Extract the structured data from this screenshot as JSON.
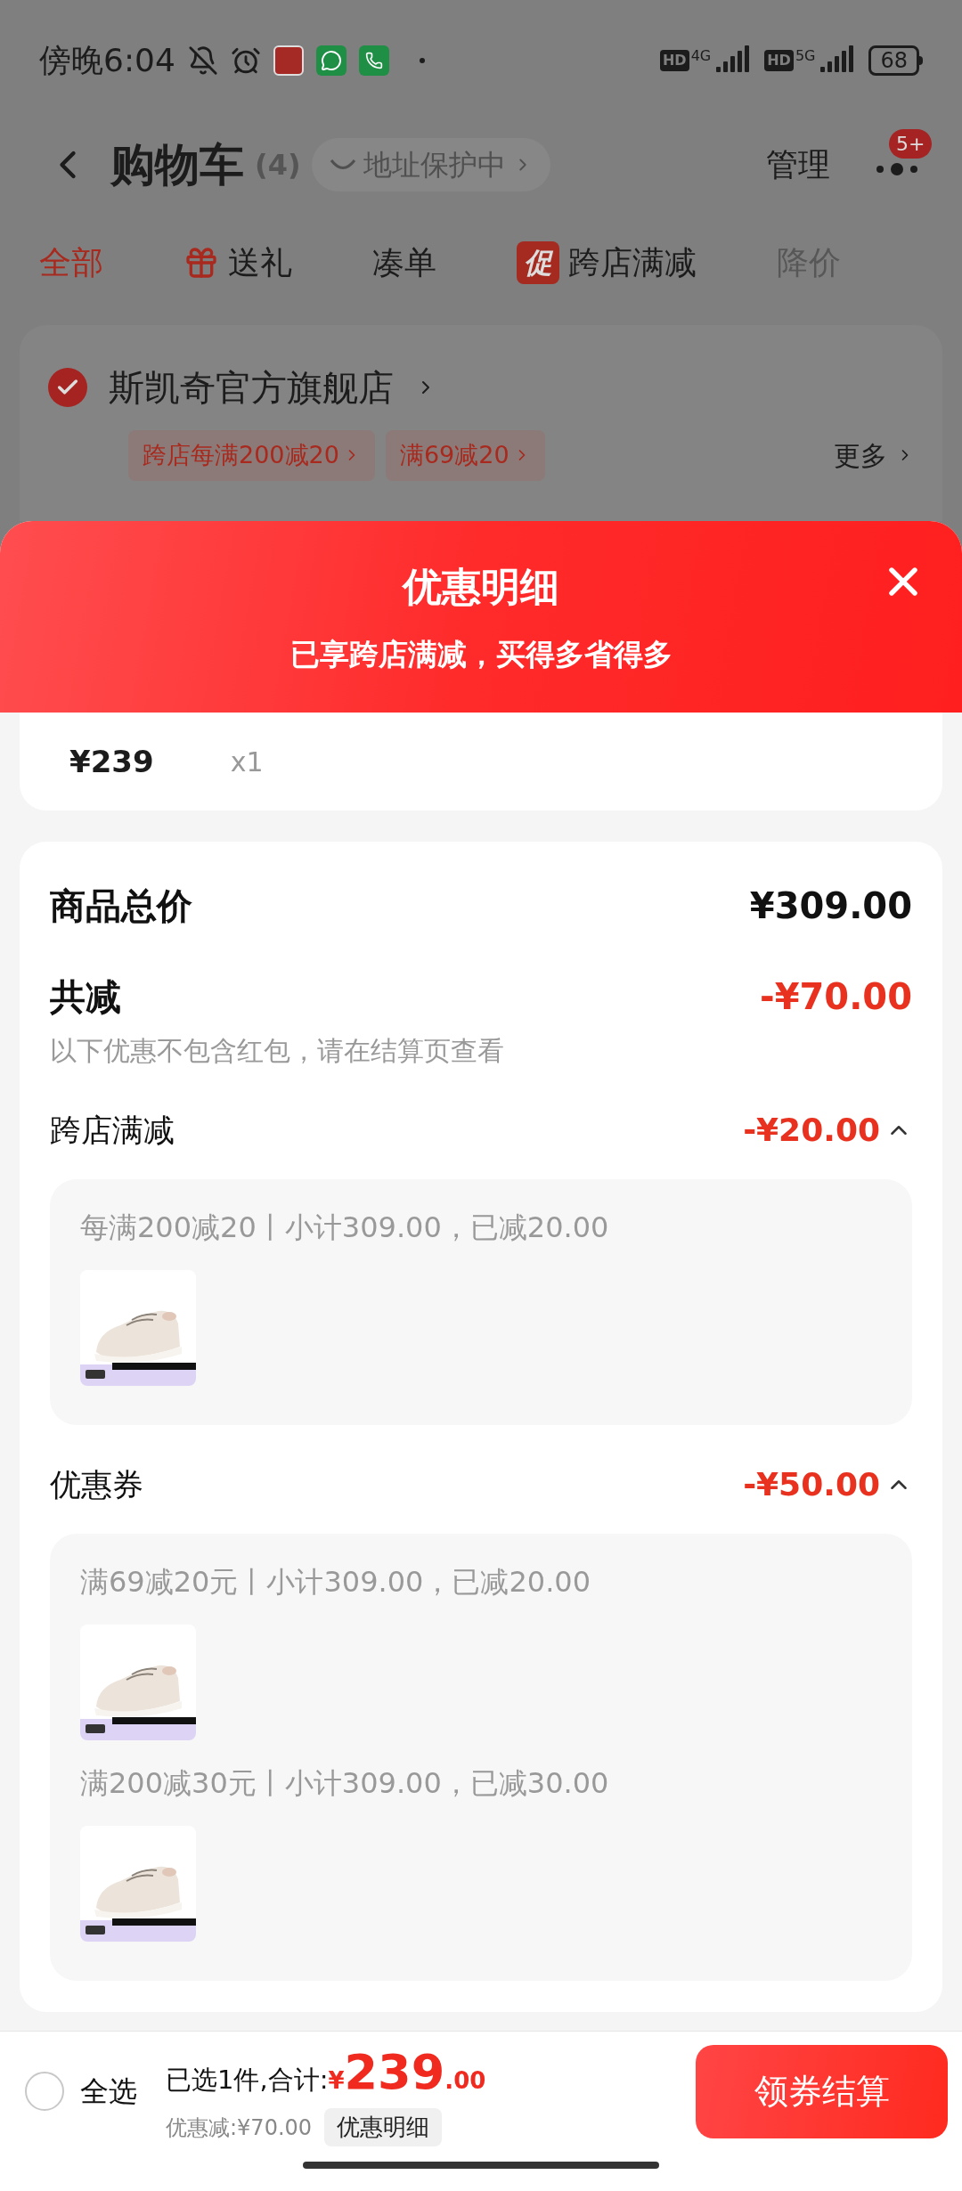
{
  "status_bar": {
    "time": "傍晚6:04",
    "network": [
      {
        "hd": "HD",
        "gen": "4G"
      },
      {
        "hd": "HD",
        "gen": "5G"
      }
    ],
    "battery": "68"
  },
  "header": {
    "title": "购物车",
    "count": "(4)",
    "address_chip": "地址保护中",
    "manage": "管理",
    "more_badge": "5+"
  },
  "tabs": [
    {
      "label": "全部",
      "selected": true,
      "disabled": false,
      "kind": "plain"
    },
    {
      "label": "送礼",
      "selected": false,
      "disabled": false,
      "kind": "gift"
    },
    {
      "label": "凑单",
      "selected": false,
      "disabled": false,
      "kind": "plain"
    },
    {
      "label": "跨店满减",
      "selected": false,
      "disabled": false,
      "kind": "promo",
      "icon_text": "促"
    },
    {
      "label": "降价",
      "selected": false,
      "disabled": true,
      "kind": "plain"
    }
  ],
  "store": {
    "name": "斯凯奇官方旗舰店",
    "checked": true,
    "tags": [
      "跨店每满200减20",
      "满69减20"
    ],
    "more": "更多"
  },
  "sheet": {
    "title": "优惠明细",
    "subtitle": "已享跨店满减，买得多省得多",
    "item": {
      "price": "¥239",
      "qty": "x1"
    },
    "total": {
      "label": "商品总价",
      "value": "¥309.00"
    },
    "discount": {
      "label": "共减",
      "value": "-¥70.00",
      "note": "以下优惠不包含红包，请在结算页查看"
    },
    "groups": [
      {
        "label": "跨店满减",
        "value": "-¥20.00",
        "expanded": true,
        "rules": [
          {
            "text": "每满200减20丨小计309.00，已减20.00"
          }
        ]
      },
      {
        "label": "优惠券",
        "value": "-¥50.00",
        "expanded": true,
        "rules": [
          {
            "text": "满69减20元丨小计309.00，已减20.00"
          },
          {
            "text": "满200减30元丨小计309.00，已减30.00"
          }
        ]
      }
    ]
  },
  "bottom_bar": {
    "select_all": "全选",
    "checked": false,
    "summary": "已选1件,合计:",
    "currency": "¥",
    "amount": "239",
    "cents": ".00",
    "saved": "优惠减:¥70.00",
    "detail_button": "优惠明细",
    "checkout": "领券结算"
  }
}
